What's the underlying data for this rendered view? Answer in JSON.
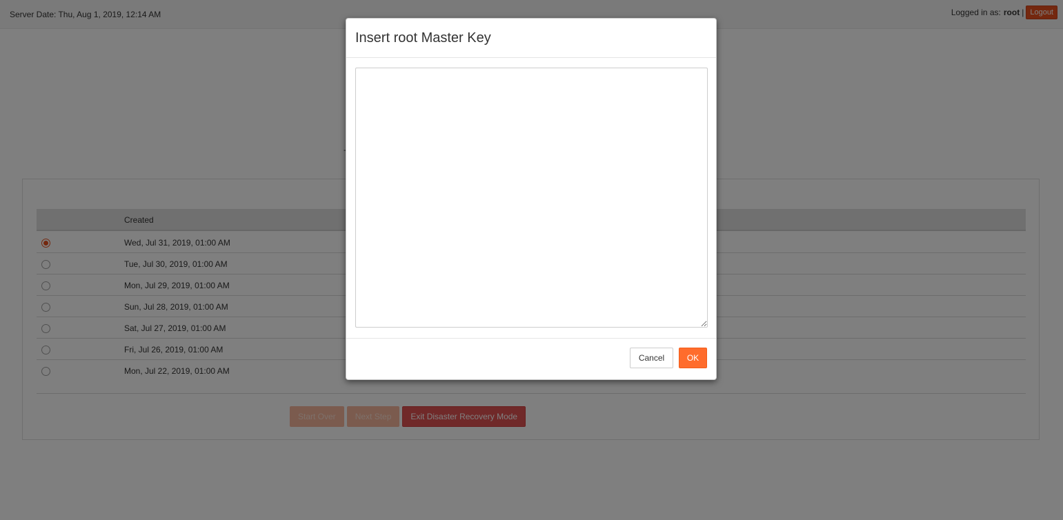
{
  "topbar": {
    "server_date": "Server Date: Thu, Aug 1, 2019, 12:14 AM",
    "logged_in_label": "Logged in as:",
    "username": "root",
    "separator": "|",
    "logout_label": "Logout"
  },
  "background": {
    "stray_text": "-"
  },
  "grid": {
    "column_created": "Created",
    "rows": [
      {
        "created": "Wed, Jul 31, 2019, 01:00 AM",
        "selected": true
      },
      {
        "created": "Tue, Jul 30, 2019, 01:00 AM",
        "selected": false
      },
      {
        "created": "Mon, Jul 29, 2019, 01:00 AM",
        "selected": false
      },
      {
        "created": "Sun, Jul 28, 2019, 01:00 AM",
        "selected": false
      },
      {
        "created": "Sat, Jul 27, 2019, 01:00 AM",
        "selected": false
      },
      {
        "created": "Fri, Jul 26, 2019, 01:00 AM",
        "selected": false
      },
      {
        "created": "Mon, Jul 22, 2019, 01:00 AM",
        "selected": false
      }
    ]
  },
  "actions": {
    "start_over": "Start Over",
    "next_step": "Next Step",
    "exit_recovery": "Exit Disaster Recovery Mode"
  },
  "modal": {
    "title": "Insert root Master Key",
    "textarea_value": "",
    "cancel_label": "Cancel",
    "ok_label": "OK"
  },
  "colors": {
    "accent": "#ff6c2c",
    "logout": "#e8501e",
    "exit_button": "#e05353",
    "overlay": "rgba(0,0,0,0.5)"
  }
}
